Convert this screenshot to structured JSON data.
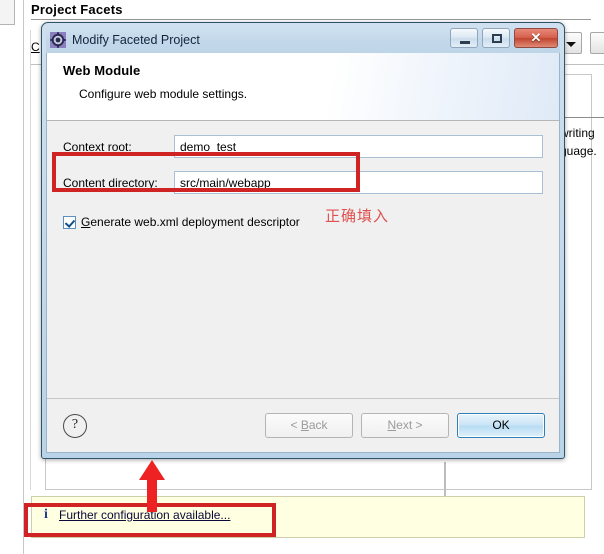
{
  "background": {
    "page_title": "Project Facets",
    "field_label": "C",
    "text_fragment_1": "writing",
    "text_fragment_2": "guage.",
    "combo_icon": "chevron-down-icon"
  },
  "dialog": {
    "title": "Modify Faceted Project",
    "icon": "faceted-project-gear-icon",
    "window_buttons": {
      "minimize": "minimize-icon",
      "maximize": "maximize-icon",
      "close": "✕"
    },
    "header": {
      "title": "Web Module",
      "description": "Configure web module settings."
    },
    "fields": [
      {
        "label_pre": "Context ",
        "label_accel": "r",
        "label_post": "oot:",
        "value": "demo_test"
      },
      {
        "label_pre": "Content ",
        "label_accel": "d",
        "label_post": "irectory:",
        "value": "src/main/webapp"
      }
    ],
    "checkbox": {
      "checked": true,
      "label_pre": "",
      "label_accel": "G",
      "label_post": "enerate web.xml deployment descriptor"
    },
    "footer": {
      "help_label": "?",
      "buttons": [
        {
          "name": "back",
          "pre": "< ",
          "accel": "B",
          "post": "ack",
          "enabled": false
        },
        {
          "name": "next",
          "pre": "",
          "accel": "N",
          "post": "ext >",
          "enabled": false
        },
        {
          "name": "ok",
          "pre": "",
          "accel": "",
          "post": "OK",
          "enabled": true
        }
      ]
    }
  },
  "info_bar": {
    "icon": "info-icon",
    "link_text": "Further configuration available...",
    "background_color": "#ffffe1"
  },
  "annotations": {
    "chinese_note": "正确填入",
    "highlight_color": "#d02424",
    "note_color": "#e05050",
    "arrow": "up-arrow-annotation"
  }
}
